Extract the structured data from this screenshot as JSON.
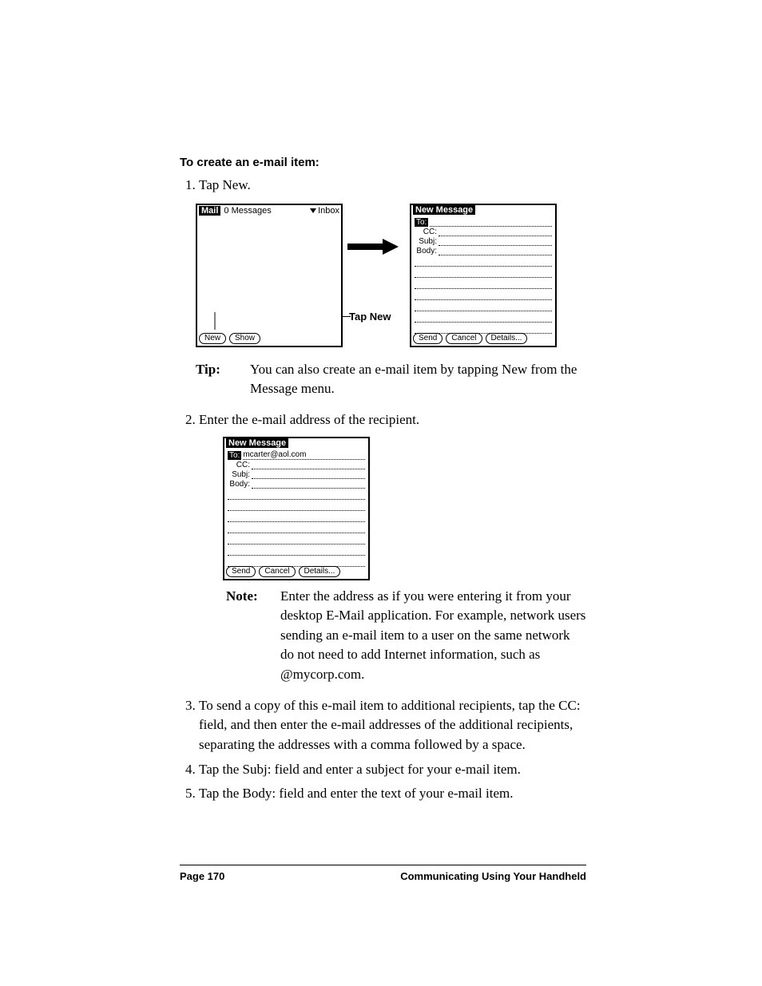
{
  "heading": "To create an e-mail item:",
  "steps": {
    "s1": "Tap New.",
    "s2": "Enter the e-mail address of the recipient.",
    "s3": "To send a copy of this e-mail item to additional recipients, tap the CC: field, and then enter the e-mail addresses of the additional recipients, separating the addresses with a comma followed by a space.",
    "s4": "Tap the Subj: field and enter a subject for your e-mail item.",
    "s5": "Tap the Body: field and enter the text of your e-mail item."
  },
  "tip": {
    "label": "Tip:",
    "text": "You can also create an e-mail item by tapping New from the Message menu."
  },
  "note": {
    "label": "Note:",
    "text": "Enter the address as if you were entering it from your desktop E-Mail application. For example, network users sending an e-mail item to a user on the same network do not need to add Internet information, such as @mycorp.com."
  },
  "callout": {
    "tapNew": "Tap New"
  },
  "figA": {
    "mail": {
      "appTitle": "Mail",
      "status": "0 Messages",
      "folder": "Inbox",
      "buttons": {
        "new": "New",
        "show": "Show"
      }
    },
    "newMsg": {
      "title": "New Message",
      "fields": {
        "to": "To:",
        "cc": "CC:",
        "subj": "Subj:",
        "body": "Body:"
      },
      "buttons": {
        "send": "Send",
        "cancel": "Cancel",
        "details": "Details..."
      }
    }
  },
  "figB": {
    "title": "New Message",
    "fields": {
      "to": "To:",
      "cc": "CC:",
      "subj": "Subj:",
      "body": "Body:"
    },
    "values": {
      "to": "mcarter@aol.com"
    },
    "buttons": {
      "send": "Send",
      "cancel": "Cancel",
      "details": "Details..."
    }
  },
  "footer": {
    "pageNum": "Page 170",
    "chapter": "Communicating Using Your Handheld"
  }
}
